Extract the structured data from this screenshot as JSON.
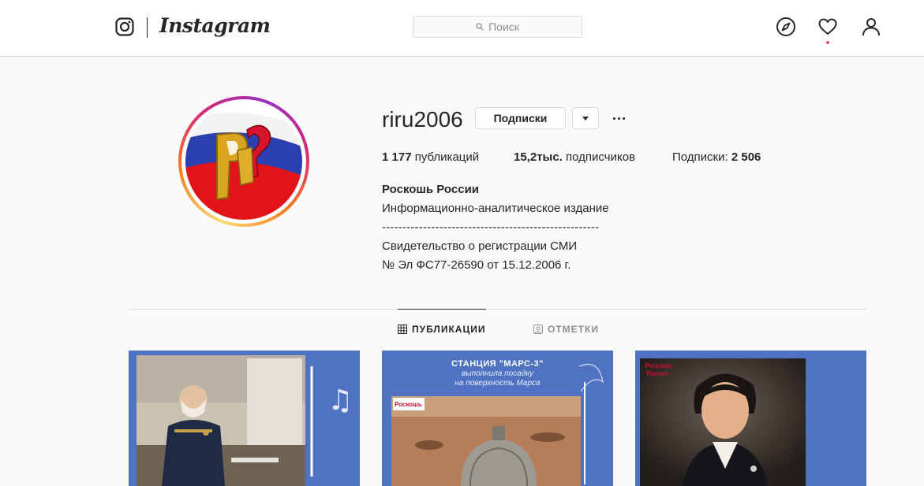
{
  "header": {
    "brand": "Instagram",
    "search_placeholder": "Поиск",
    "icons": [
      "instagram-glyph-icon",
      "search-icon",
      "compass-icon",
      "heart-icon",
      "user-icon"
    ]
  },
  "profile": {
    "username": "riru2006",
    "follow_button": "Подписки",
    "stats": {
      "posts_count": "1 177",
      "posts_label": "публикаций",
      "followers_count": "15,2тыс.",
      "followers_label": "подписчиков",
      "following_label": "Подписки:",
      "following_count": "2 506"
    },
    "bio": {
      "name": "Роскошь России",
      "line1": "Информационно-аналитическое издание",
      "line2": "-----------------------------------------------------",
      "line3": "Свидетельство о регистрации СМИ",
      "line4": "№ Эл ФС77-26590 от 15.12.2006 г."
    }
  },
  "tabs": {
    "posts": "ПУБЛИКАЦИИ",
    "tagged": "ОТМЕТКИ"
  },
  "posts": {
    "post2_title": "СТАНЦИЯ \"МАРС-3\"",
    "post2_sub1": "выполнила посадку",
    "post2_sub2": "на поверхность Марса"
  },
  "colors": {
    "accent_blue": "#4f73c2",
    "notification": "#ed4956",
    "border": "#dbdbdb"
  }
}
